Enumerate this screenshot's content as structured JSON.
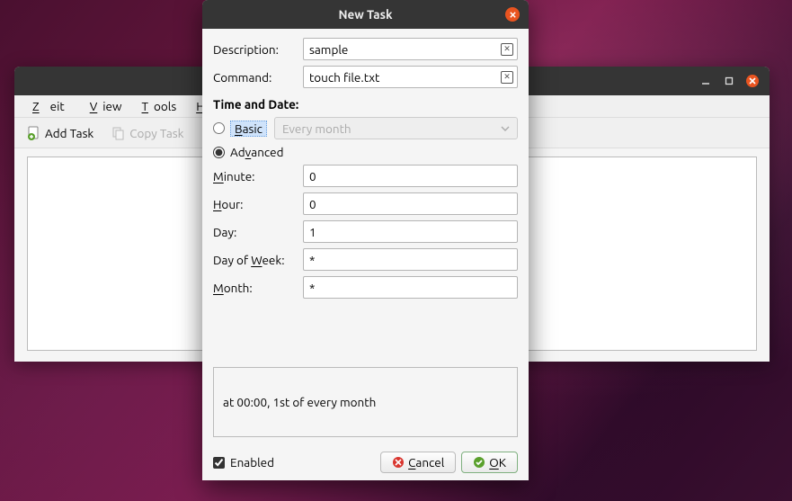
{
  "main": {
    "menu": {
      "zeit": "Zeit",
      "view": "View",
      "tools": "Tools",
      "help": "Help"
    },
    "toolbar": {
      "add": "Add Task",
      "copy": "Copy Task"
    }
  },
  "dialog": {
    "title": "New Task",
    "fields": {
      "description_label": "Description:",
      "description_value": "sample",
      "command_label": "Command:",
      "command_value": "touch file.txt"
    },
    "timedate": {
      "heading": "Time and Date:",
      "basic_label": "Basic",
      "advanced_label": "Advanced",
      "dropdown_value": "Every month",
      "minute_label": "Minute:",
      "minute_value": "0",
      "hour_label": "Hour:",
      "hour_value": "0",
      "day_label": "Day:",
      "day_value": "1",
      "dow_label": "Day of Week:",
      "dow_value": "*",
      "month_label": "Month:",
      "month_value": "*"
    },
    "summary": "at 00:00, 1st of every month",
    "footer": {
      "enabled_label": "Enabled",
      "cancel": "Cancel",
      "ok": "OK"
    }
  }
}
